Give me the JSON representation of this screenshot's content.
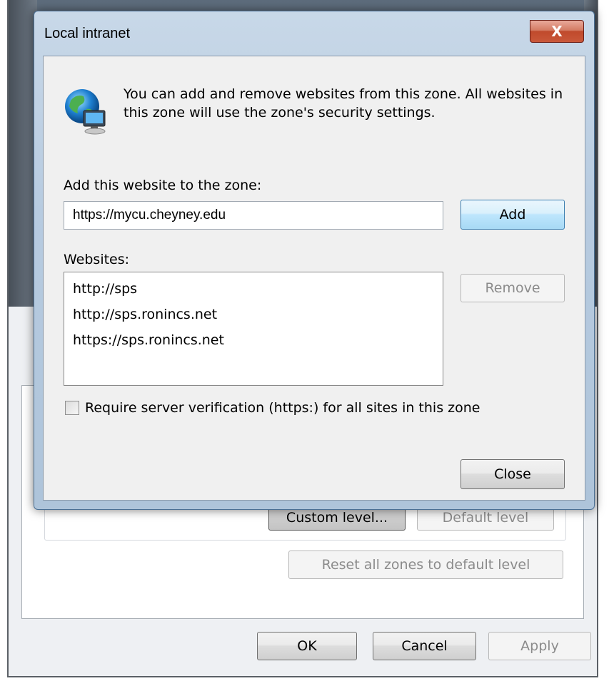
{
  "dialog": {
    "title": "Local intranet",
    "close_glyph": "X",
    "info_icon": "globe-computer-icon",
    "info_text": "You can add and remove websites from this zone. All websites in this zone will use the zone's security settings.",
    "add_label": "Add this website to the zone:",
    "add_value": "https://mycu.cheyney.edu",
    "add_button": "Add",
    "websites_label": "Websites:",
    "websites": [
      "http://sps",
      "http://sps.ronincs.net",
      "https://sps.ronincs.net"
    ],
    "remove_button": "Remove",
    "require_https_label": "Require server verification (https:) for all sites in this zone",
    "require_https_checked": false,
    "close_button": "Close"
  },
  "background": {
    "custom_level_button": "Custom level...",
    "default_level_button": "Default level",
    "reset_button": "Reset all zones to default level",
    "ok_button": "OK",
    "cancel_button": "Cancel",
    "apply_button": "Apply"
  },
  "colors": {
    "dialog_frame": "#b7cbe0",
    "close_red": "#c04a2c",
    "primary_button": "#bee6fd"
  }
}
